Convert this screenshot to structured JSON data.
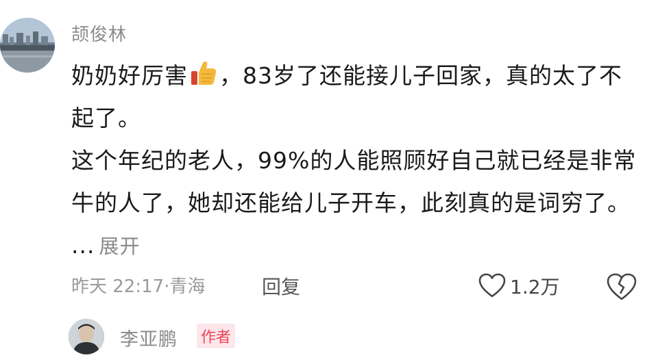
{
  "comment": {
    "username": "颉俊林",
    "text_before_emoji": "奶奶好厉害",
    "emoji": "thumbs-up-icon",
    "text_after_emoji": "，83岁了还能接儿子回家，真的太了不起了。",
    "paragraph2": "这个年纪的老人，99%的人能照顾好自己就已经是非常牛的人了，她却还能给儿子开车，此刻真的是词穷了。",
    "ellipsis": "...",
    "expand_label": "展开",
    "meta": "昨天 22:17·青海",
    "reply_label": "回复",
    "like_count": "1.2万"
  },
  "reply": {
    "username": "李亚鹏",
    "badge": "作者"
  },
  "colors": {
    "text": "#1a1a1a",
    "muted": "#8a8a8a",
    "badge_bg": "#fde7ea",
    "badge_text": "#e8455c",
    "thumb": "#f5b83d"
  }
}
